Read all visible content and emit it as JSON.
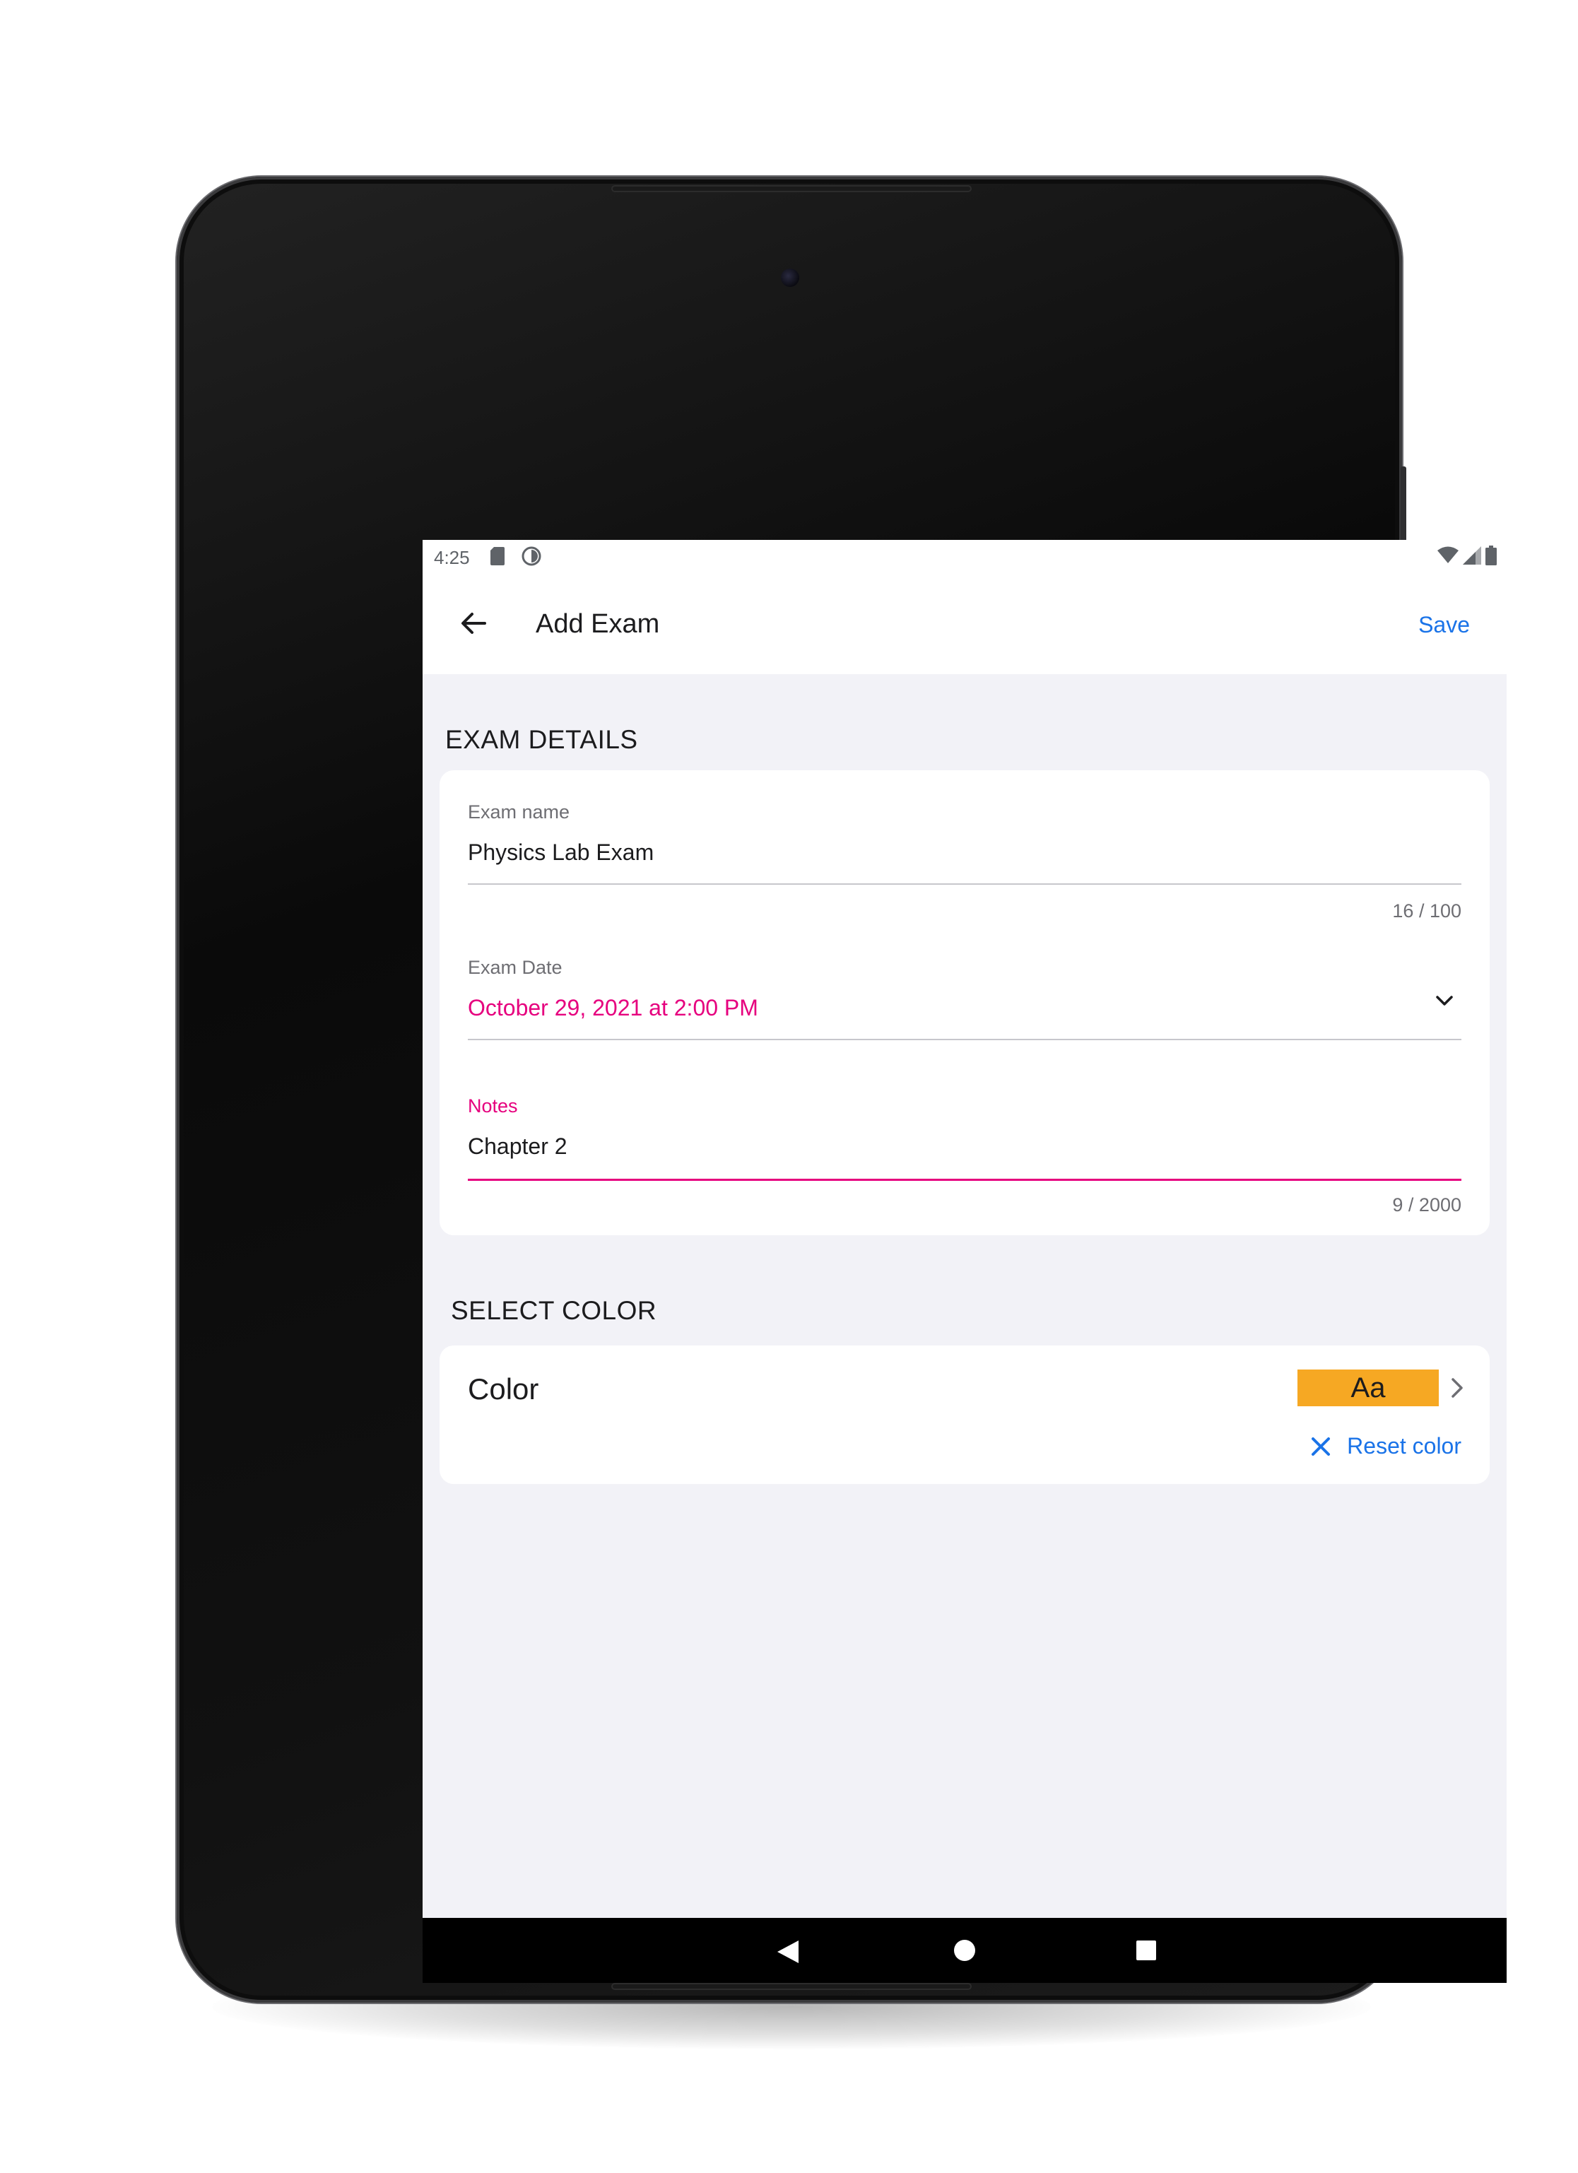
{
  "status_bar": {
    "time": "4:25",
    "icons": [
      "sd-card-icon",
      "circle-icon",
      "wifi-icon",
      "signal-icon",
      "battery-icon"
    ]
  },
  "app_bar": {
    "title": "Add Exam",
    "save_label": "Save",
    "back_icon": "arrow-back-icon"
  },
  "exam_details": {
    "section_title": "EXAM DETAILS",
    "exam_name": {
      "label": "Exam name",
      "value": "Physics Lab Exam",
      "counter": "16 / 100"
    },
    "exam_date": {
      "label": "Exam Date",
      "value": "October 29, 2021 at 2:00 PM"
    },
    "notes": {
      "label": "Notes",
      "value": "Chapter 2",
      "counter": "9 / 2000"
    }
  },
  "select_color": {
    "section_title": "SELECT COLOR",
    "color_label": "Color",
    "swatch_text": "Aa",
    "swatch_color": "#f6a823",
    "reset_label": "Reset color"
  },
  "colors": {
    "accent_pink": "#e6007e",
    "link_blue": "#1a73e8",
    "background": "#f2f2f7"
  },
  "nav_bar": {
    "icons": [
      "nav-back-icon",
      "nav-home-icon",
      "nav-recents-icon"
    ]
  }
}
